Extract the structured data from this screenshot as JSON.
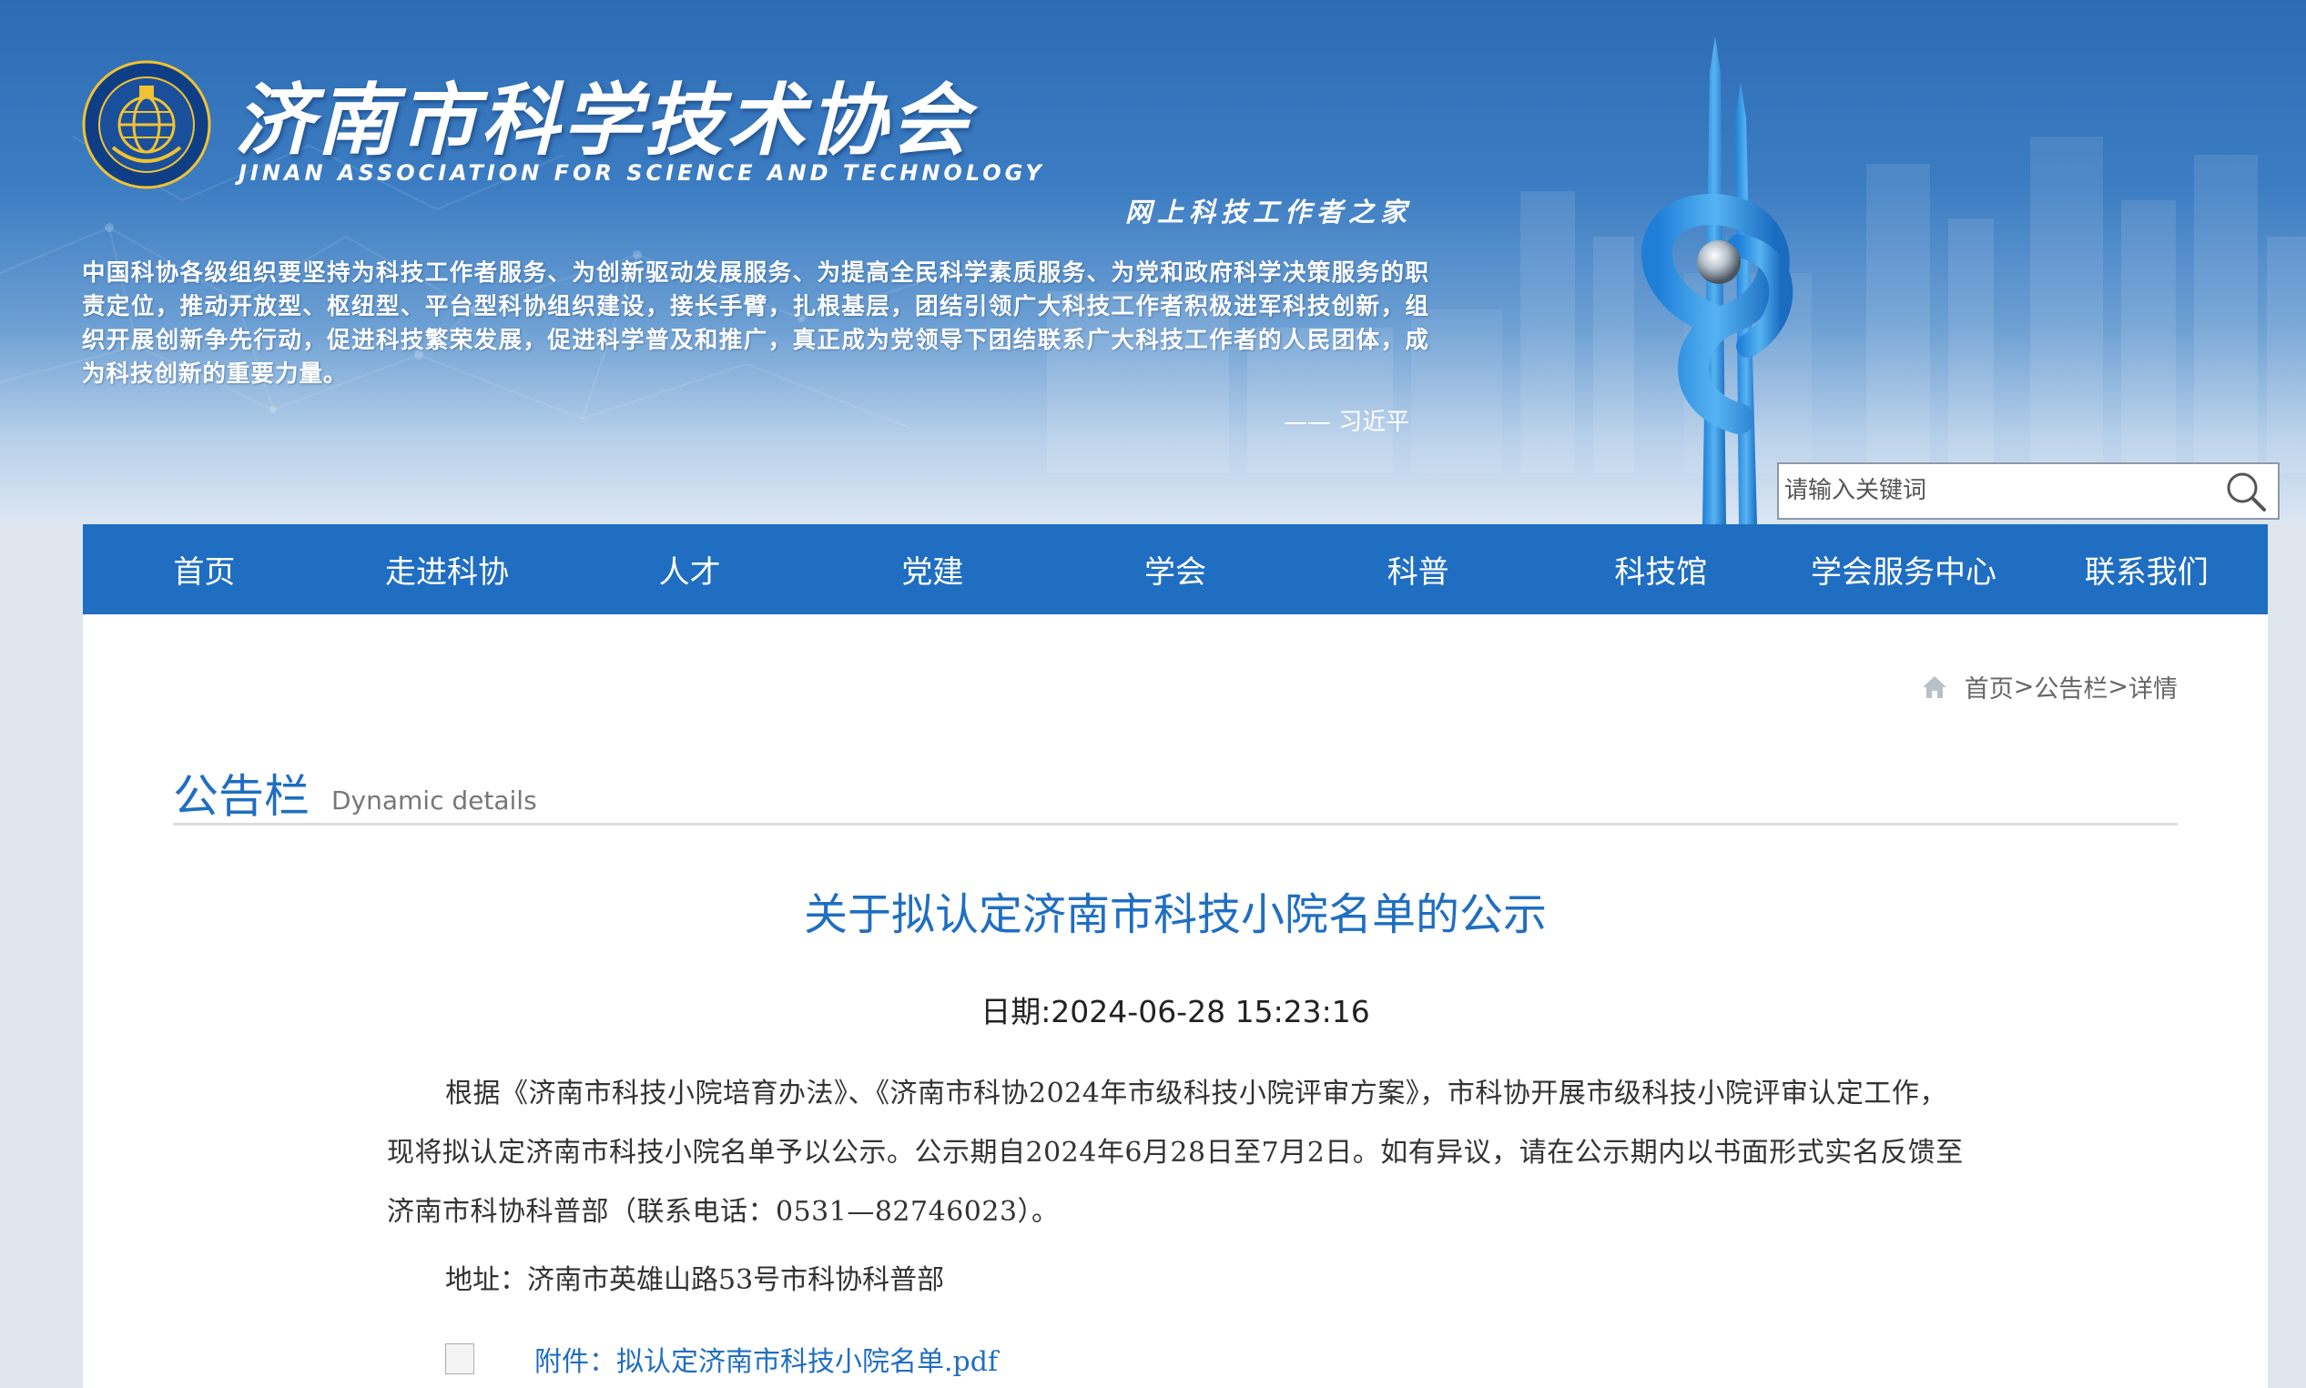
{
  "site": {
    "title": "济南市科学技术协会",
    "title_en": "JINAN ASSOCIATION FOR SCIENCE AND TECHNOLOGY",
    "slogan": "网上科技工作者之家",
    "quote": "中国科协各级组织要坚持为科技工作者服务、为创新驱动发展服务、为提高全民科学素质服务、为党和政府科学决策服务的职责定位，推动开放型、枢纽型、平台型科协组织建设，接长手臂，扎根基层，团结引领广大科技工作者积极进军科技创新，组织开展创新争先行动，促进科技繁荣发展，促进科学普及和推广，真正成为党领导下团结联系广大科技工作者的人民团体，成为科技创新的重要力量。",
    "quote_author": "—— 习近平"
  },
  "search": {
    "placeholder": "请输入关键词"
  },
  "nav": [
    {
      "label": "首页"
    },
    {
      "label": "走进科协"
    },
    {
      "label": "人才"
    },
    {
      "label": "党建"
    },
    {
      "label": "学会"
    },
    {
      "label": "科普"
    },
    {
      "label": "科技馆"
    },
    {
      "label": "学会服务中心"
    },
    {
      "label": "联系我们"
    }
  ],
  "breadcrumb": {
    "home": "首页",
    "sep1": ">",
    "section": "公告栏",
    "sep2": ">",
    "current": "详情"
  },
  "section": {
    "title": "公告栏",
    "subtitle": "Dynamic details"
  },
  "article": {
    "title": "关于拟认定济南市科技小院名单的公示",
    "date": "日期:2024-06-28 15:23:16",
    "body": "根据《济南市科技小院培育办法》、《济南市科协2024年市级科技小院评审方案》，市科协开展市级科技小院评审认定工作，现将拟认定济南市科技小院名单予以公示。公示期自2024年6月28日至7月2日。如有异议，请在公示期内以书面形式实名反馈至济南市科协科普部（联系电话：0531—82746023）。",
    "address": "地址：济南市英雄山路53号市科协科普部",
    "attachment": "附件：拟认定济南市科技小院名单.pdf"
  },
  "colors": {
    "primary": "#1f6ec2",
    "banner_top": "#2d6cb4"
  },
  "icons": {
    "search": "search-icon",
    "home": "home-icon",
    "logo": "association-emblem"
  }
}
